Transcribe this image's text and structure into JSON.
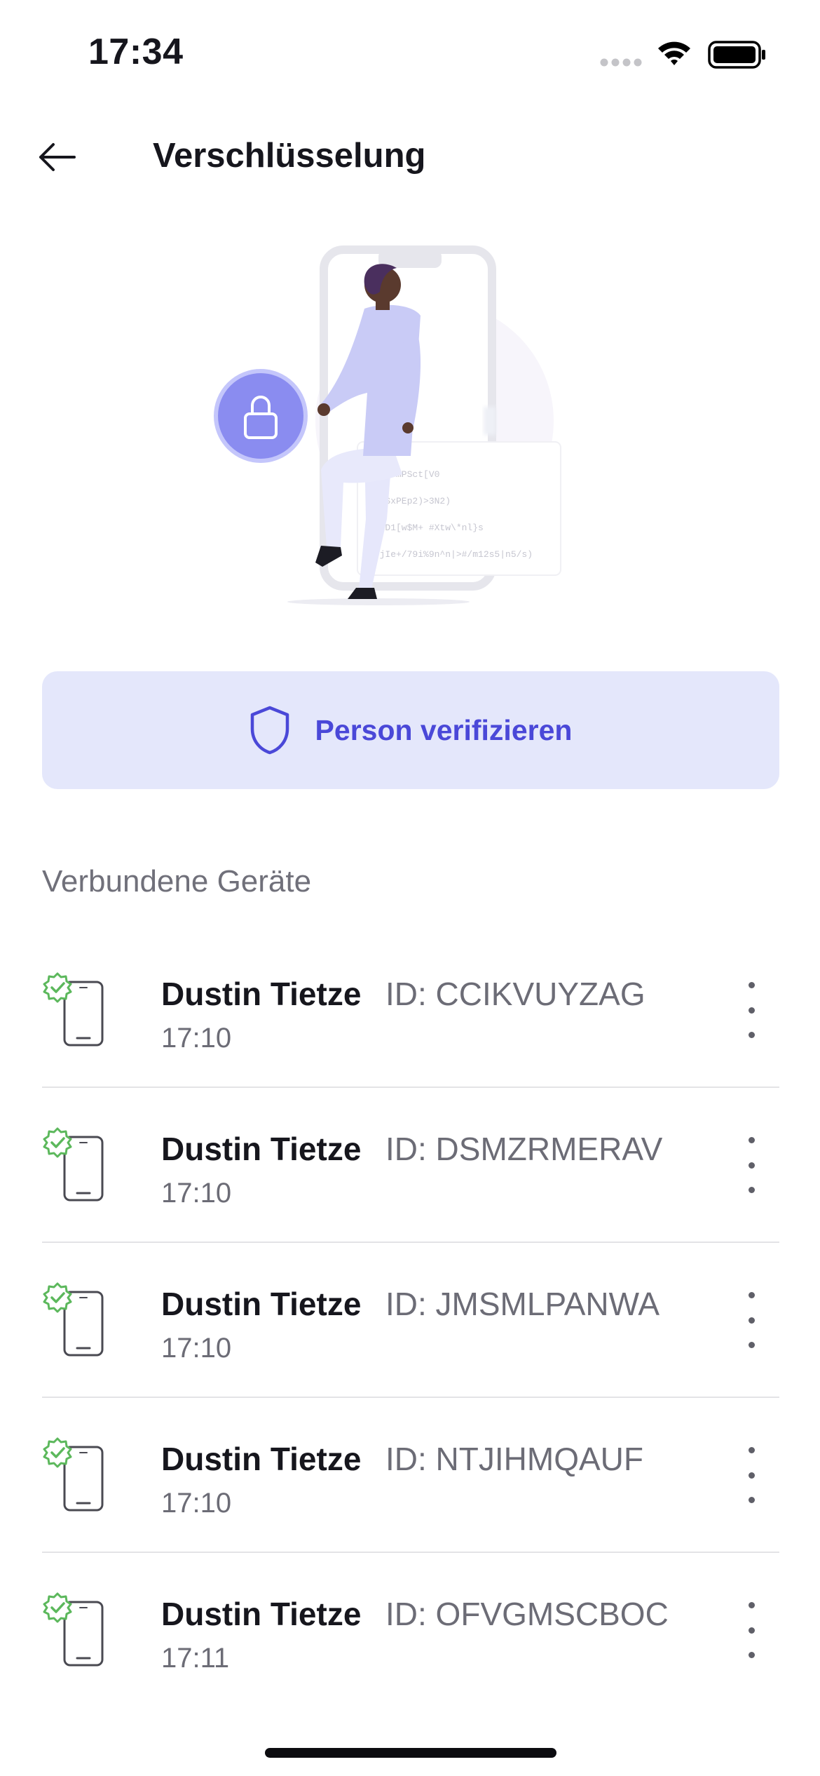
{
  "status_bar": {
    "time": "17:34"
  },
  "header": {
    "title": "Verschlüsselung"
  },
  "illustration": {
    "code_lines": [
      "$#N^SmPSct[V0",
      "Iq(SxPEp2)>3N2)",
      "A4xD1[w$M+ #Xtw\\*nl}s",
      "#(jIe+/79i%9n^n|>#/m12s5|n5/s)"
    ]
  },
  "verify": {
    "label": "Person verifizieren"
  },
  "devices_section": {
    "title": "Verbundene Geräte",
    "items": [
      {
        "name": "Dustin Tietze",
        "id": "ID: CCIKVUYZAG",
        "time": "17:10"
      },
      {
        "name": "Dustin Tietze",
        "id": "ID: DSMZRMERAV",
        "time": "17:10"
      },
      {
        "name": "Dustin Tietze",
        "id": "ID: JMSMLPANWA",
        "time": "17:10"
      },
      {
        "name": "Dustin Tietze",
        "id": "ID: NTJIHMQAUF",
        "time": "17:10"
      },
      {
        "name": "Dustin Tietze",
        "id": "ID: OFVGMSCBOC",
        "time": "17:11"
      }
    ]
  },
  "colors": {
    "accent": "#4a48d8",
    "button_bg": "#e4e7fb",
    "verified_green": "#5cb85c",
    "lock_circle": "#8a8cf0"
  },
  "icons": {
    "back": "arrow-left-icon",
    "verify": "shield-icon",
    "device": "smartphone-icon",
    "verified": "verified-badge-icon",
    "more": "more-vertical-icon"
  }
}
